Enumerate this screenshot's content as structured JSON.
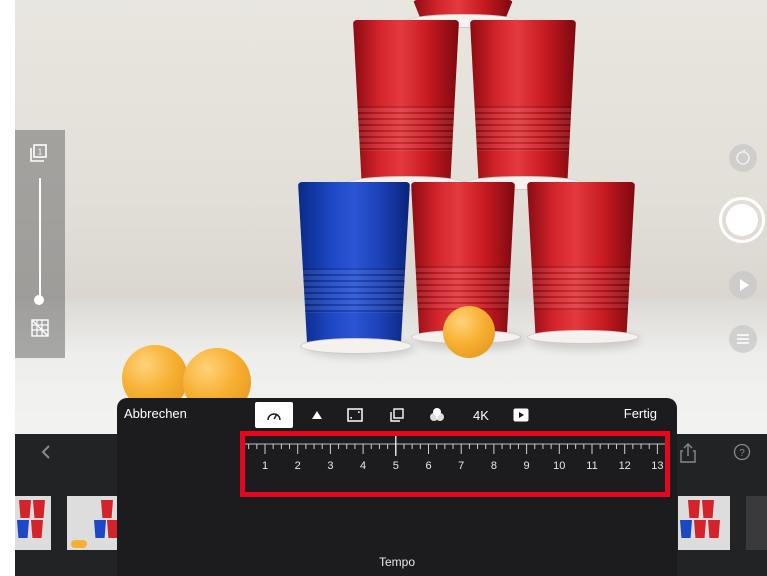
{
  "editor": {
    "cancel_label": "Abbrechen",
    "done_label": "Fertig",
    "title": "Tempo",
    "tools": [
      {
        "name": "speed-gauge-icon",
        "label": "",
        "active": true
      },
      {
        "name": "triangle-up-icon",
        "label": "",
        "active": false
      },
      {
        "name": "crop-frame-icon",
        "label": "",
        "active": false
      },
      {
        "name": "layers-icon",
        "label": "",
        "active": false
      },
      {
        "name": "color-filter-icon",
        "label": "",
        "active": false
      },
      {
        "name": "resolution-4k",
        "label": "4K",
        "active": false
      },
      {
        "name": "play-preview-icon",
        "label": "",
        "active": false
      }
    ]
  },
  "speed_ruler": {
    "labels": [
      "1",
      "2",
      "3",
      "4",
      "5",
      "6",
      "7",
      "8",
      "9",
      "10",
      "11",
      "12",
      "13"
    ],
    "current": "5"
  },
  "sidebar_icons": {
    "back": "chevron-left-icon",
    "share": "share-icon",
    "help": "help-icon"
  },
  "colors": {
    "highlight": "#e3081f",
    "panel_bg": "#1c1c1e",
    "cup_red": "#d3242c",
    "cup_blue": "#1d47c4",
    "ball_orange": "#f7b032"
  }
}
